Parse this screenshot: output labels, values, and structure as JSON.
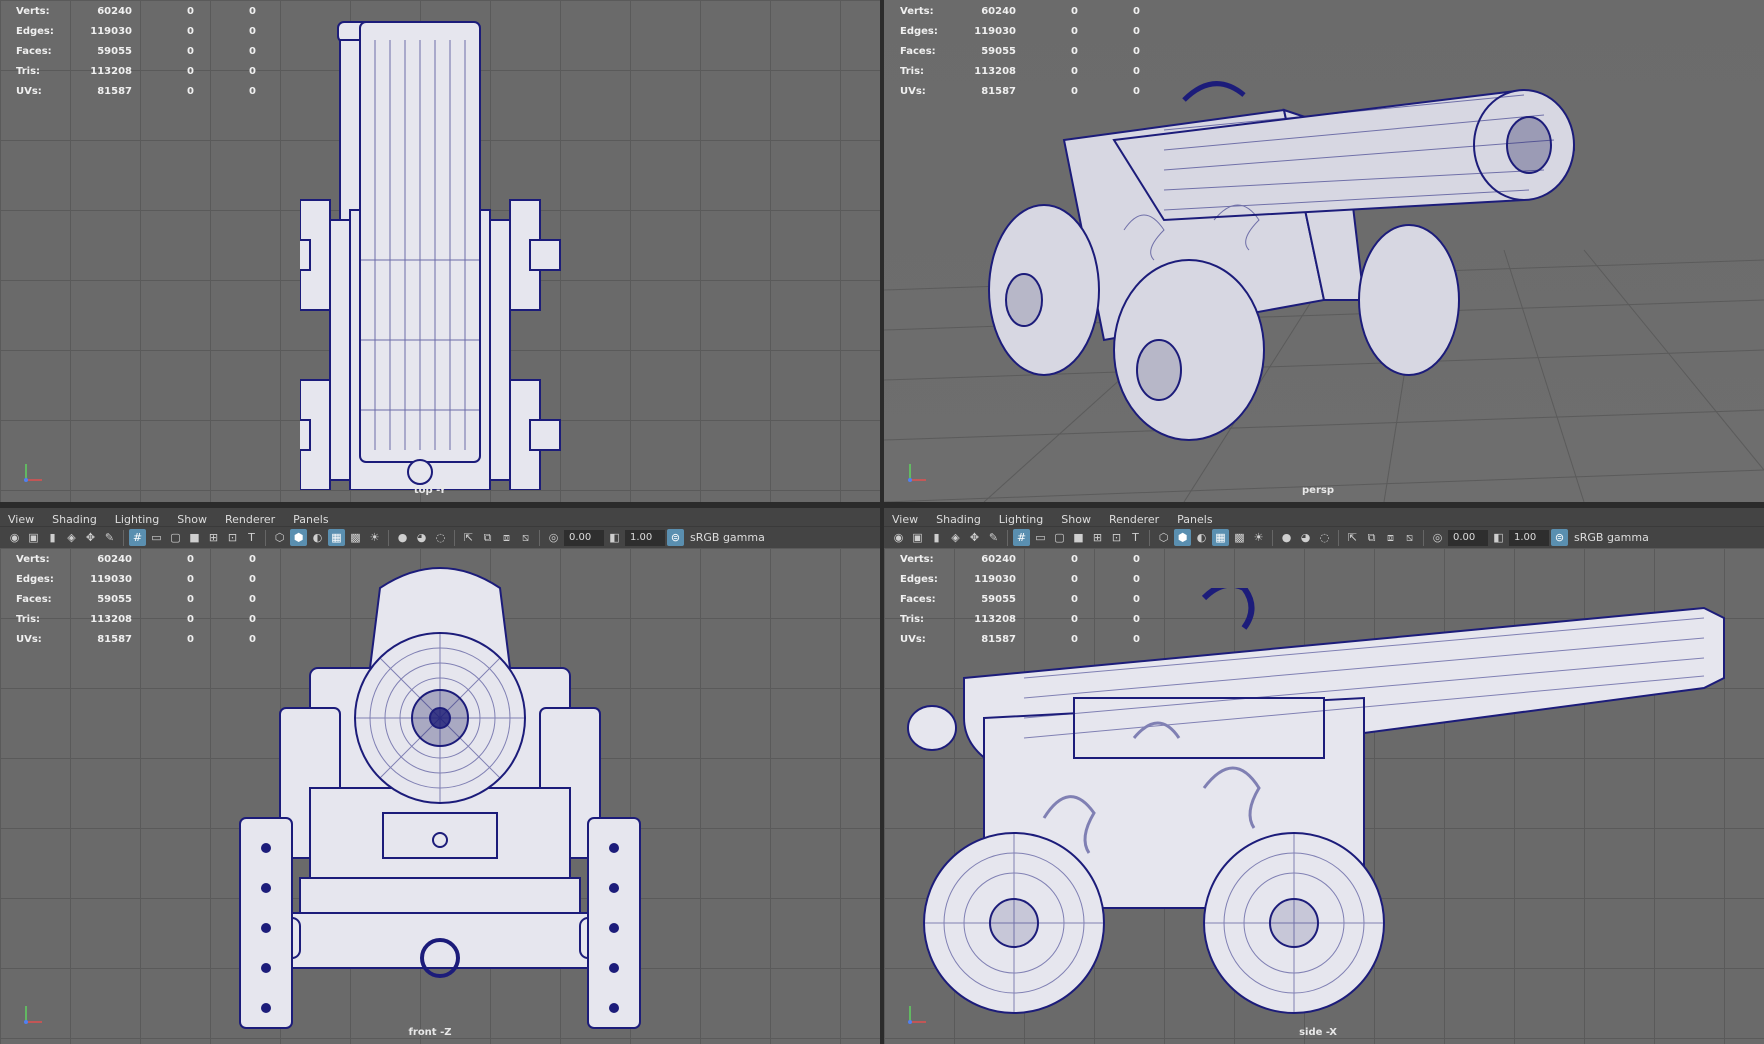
{
  "stats": {
    "labels": [
      "Verts:",
      "Edges:",
      "Faces:",
      "Tris:",
      "UVs:"
    ],
    "values": [
      "60240",
      "119030",
      "59055",
      "113208",
      "81587"
    ],
    "col2": "0",
    "col3": "0"
  },
  "viewports": {
    "top": {
      "label": "top -Y"
    },
    "persp": {
      "label": "persp"
    },
    "front": {
      "label": "front -Z"
    },
    "side": {
      "label": "side -X"
    }
  },
  "menu": [
    "View",
    "Shading",
    "Lighting",
    "Show",
    "Renderer",
    "Panels"
  ],
  "toolbar": {
    "exposure": "0.00",
    "gamma": "1.00",
    "color_space": "sRGB gamma"
  },
  "colors": {
    "viewport_bg": "#6a6a6a",
    "wire": "#1c1c7a",
    "model_fill": "#e6e6ee",
    "panel": "#444444"
  }
}
